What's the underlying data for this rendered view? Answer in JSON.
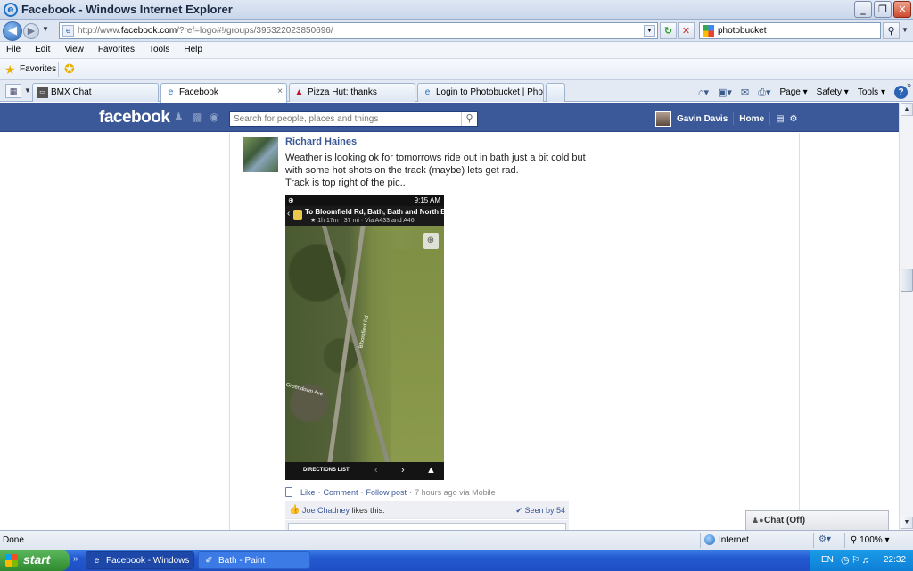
{
  "window": {
    "title": "Facebook - Windows Internet Explorer",
    "minimize": "_",
    "maximize": "❐",
    "close": "✕"
  },
  "address_bar": {
    "url_prefix": "http://www.",
    "url_domain": "facebook.com",
    "url_suffix": "/?ref=logo#!/groups/395322023850696/",
    "search_value": "photobucket"
  },
  "menu": {
    "items": [
      "File",
      "Edit",
      "View",
      "Favorites",
      "Tools",
      "Help"
    ]
  },
  "favorites_bar": {
    "label": "Favorites"
  },
  "tabs": {
    "items": [
      {
        "label": "BMX Chat",
        "icon": "chat-window-icon"
      },
      {
        "label": "Facebook",
        "icon": "ie-page-icon",
        "active": true
      },
      {
        "label": "Pizza Hut: thanks",
        "icon": "pizza-hut-icon"
      },
      {
        "label": "Login to Photobucket | Photo...",
        "icon": "photobucket-icon"
      }
    ],
    "close_glyph": "×"
  },
  "command_bar": {
    "page": "Page",
    "safety": "Safety",
    "tools": "Tools"
  },
  "facebook": {
    "logo": "facebook",
    "search_placeholder": "Search for people, places and things",
    "user_name": "Gavin Davis",
    "home_label": "Home"
  },
  "post": {
    "author": "Richard Haines",
    "text_lines": [
      "Weather is looking ok for tomorrows ride out in bath just a bit cold but",
      "with some hot shots on the track (maybe) lets get rad.",
      "Track is top right of the pic.."
    ],
    "photo": {
      "status_time": "9:15 AM",
      "status_left": "⊕",
      "destination": "To Bloomfield Rd, Bath, Bath and North E...",
      "route_meta": "★ 1h 17m · 37 mi · Via A433 and A46",
      "street_label_1": "Bloomfield Rd",
      "street_label_2": "Greendown Ave",
      "directions_label": "DIRECTIONS LIST"
    },
    "actions": {
      "like": "Like",
      "comment": "Comment",
      "follow": "Follow post",
      "time": "7 hours ago via Mobile"
    },
    "likes": {
      "name": "Joe Chadney",
      "suffix": " likes this.",
      "seen": "Seen by 54"
    }
  },
  "chat": {
    "label": "Chat (Off)"
  },
  "status_bar": {
    "status": "Done",
    "zone": "Internet",
    "zoom": "100%"
  },
  "taskbar": {
    "start": "start",
    "items": [
      {
        "label": "Facebook - Windows ..."
      },
      {
        "label": "Bath - Paint"
      }
    ],
    "language": "EN",
    "clock": "22:32"
  }
}
